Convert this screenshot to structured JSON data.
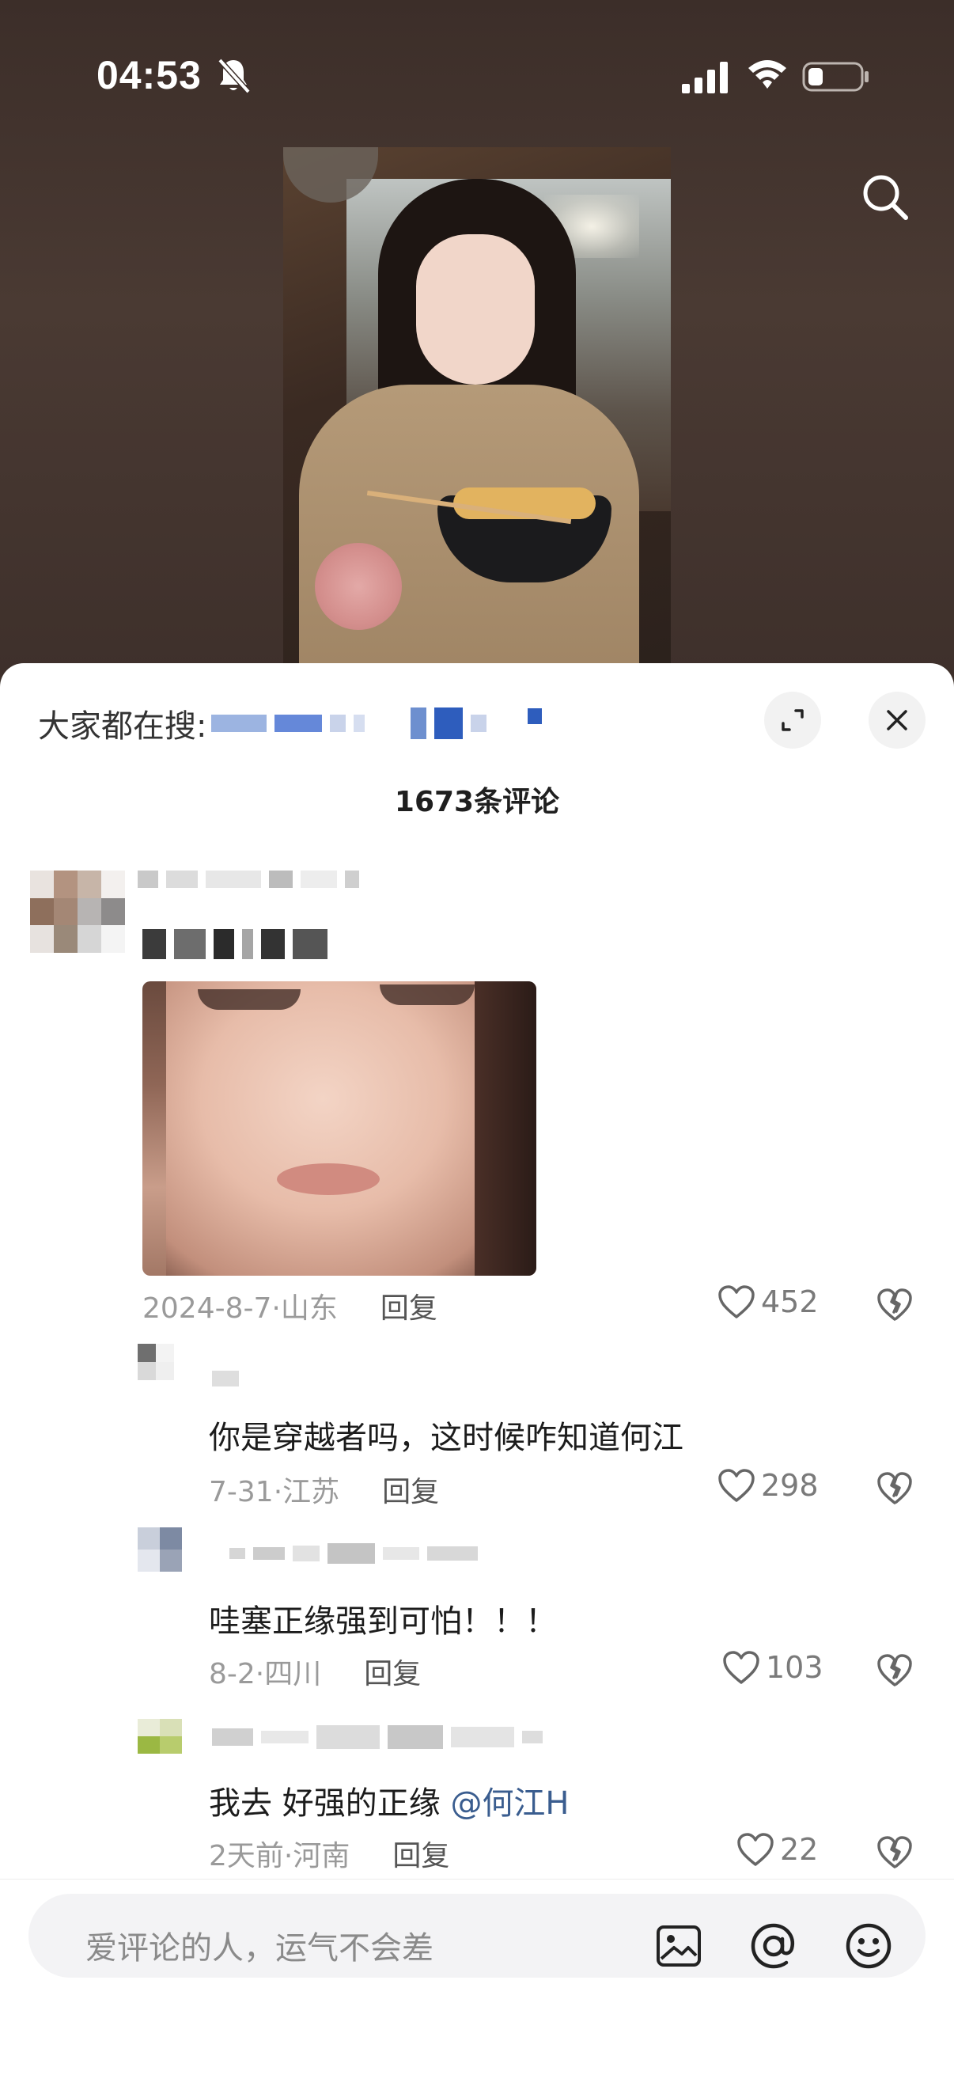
{
  "status_bar": {
    "time": "04:53",
    "icons": [
      "bell-slash-icon",
      "cellular-signal-icon",
      "wifi-icon",
      "battery-icon"
    ]
  },
  "video": {
    "icons": [
      "search-icon"
    ]
  },
  "sheet": {
    "trending_label": "大家都在搜:",
    "comment_count": "1673条评论",
    "icons": [
      "expand-icon",
      "close-icon"
    ]
  },
  "comments": [
    {
      "text": "",
      "date": "2024-8-7·山东",
      "reply_label": "回复",
      "likes": "452"
    },
    {
      "text": "你是穿越者吗，这时候咋知道何江",
      "date": "7-31·江苏",
      "reply_label": "回复",
      "likes": "298"
    },
    {
      "text": "哇塞正缘强到可怕！！！",
      "date": "8-2·四川",
      "reply_label": "回复",
      "likes": "103"
    },
    {
      "text_prefix": "我去 好强的正缘",
      "mention": "@何江H",
      "date": "2天前·河南",
      "reply_label": "回复",
      "likes": "22"
    }
  ],
  "input": {
    "placeholder": "爱评论的人，运气不会差",
    "icons": [
      "image-icon",
      "at-icon",
      "emoji-icon"
    ]
  },
  "colors": {
    "background": "#3b2f2a",
    "sheet": "#ffffff",
    "muted_text": "#9a9a9a",
    "mention": "#3a5d8f"
  }
}
